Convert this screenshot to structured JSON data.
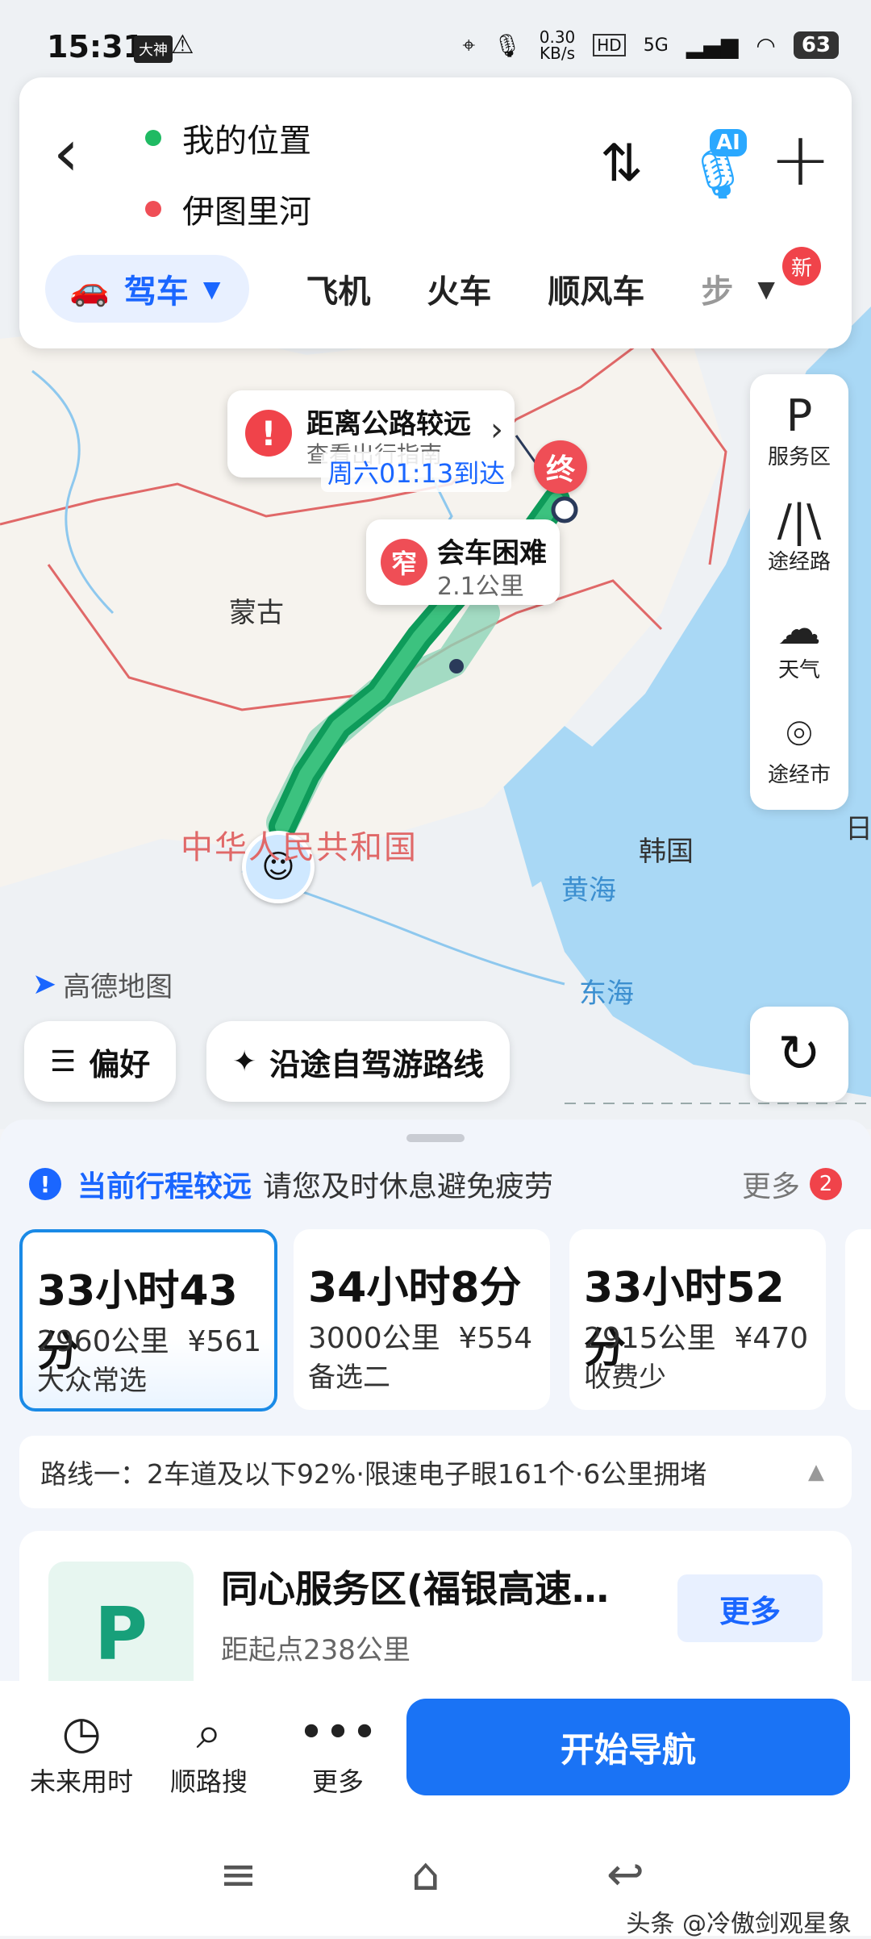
{
  "status_bar": {
    "time": "15:31",
    "badge": "大神",
    "speed_value": "0.30",
    "speed_unit": "KB/s",
    "hd": "HD",
    "network": "5G",
    "battery": "63"
  },
  "route_header": {
    "origin": "我的位置",
    "destination": "伊图里河",
    "ai_label": "AI",
    "modes": {
      "selected": "驾车",
      "items": [
        "飞机",
        "火车",
        "顺风车",
        "步"
      ],
      "new_badge": "新"
    }
  },
  "map": {
    "callout_far": {
      "title": "距离公路较远",
      "sub": "查看出行指南",
      "eta": "周六01:13到达"
    },
    "callout_narrow": {
      "badge": "窄",
      "title": "会车困难",
      "sub": "2.1公里"
    },
    "end_marker": "终",
    "labels": {
      "mongolia": "蒙古",
      "china": "中华人民共和国",
      "korea": "韩国",
      "yellow_sea": "黄海",
      "east_sea": "东海",
      "japan": "日"
    },
    "brand": "高德地图",
    "side_panel": [
      "服务区",
      "途经路",
      "天气",
      "途经市"
    ],
    "preference": "偏好",
    "scenic_route": "沿途自驾游路线"
  },
  "sheet": {
    "notice_title": "当前行程较远",
    "notice_text": "请您及时休息避免疲劳",
    "notice_more": "更多",
    "notice_count": "2",
    "routes": [
      {
        "time": "33小时43分",
        "distance": "2960公里",
        "cost": "¥561",
        "tag": "大众常选"
      },
      {
        "time": "34小时8分",
        "distance": "3000公里",
        "cost": "¥554",
        "tag": "备选二"
      },
      {
        "time": "33小时52分",
        "distance": "2915公里",
        "cost": "¥470",
        "tag": "收费少"
      }
    ],
    "route_info": "路线一：2车道及以下92%·限速电子眼161个·6公里拥堵",
    "poi": {
      "title": "同心服务区(福银高速…",
      "distance": "距起点238公里",
      "more": "更多",
      "icon": "P"
    }
  },
  "bottom": {
    "future_time": "未来用时",
    "search_along": "顺路搜",
    "more": "更多",
    "start_nav": "开始导航"
  },
  "watermark": "头条 @冷傲剑观星象"
}
